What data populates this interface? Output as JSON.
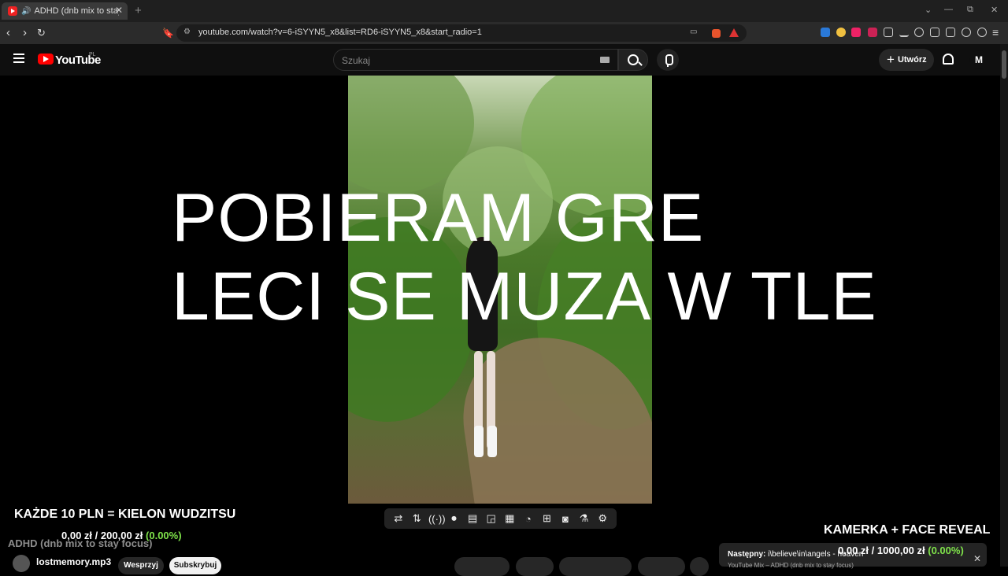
{
  "browser": {
    "tab_title": "ADHD (dnb mix to stay focus)",
    "new_tab": "+",
    "url": "youtube.com/watch?v=6-iSYYN5_x8&list=RD6-iSYYN5_x8&start_radio=1",
    "win_controls": [
      "⌄",
      "—",
      "⧉",
      "✕"
    ]
  },
  "youtube": {
    "logo_text": "YouTube",
    "country": "PL",
    "search_placeholder": "Szukaj",
    "create_label": "Utwórz",
    "avatar_letter": "M"
  },
  "video": {
    "overlay_line1": "POBIERAM GRE",
    "overlay_line2": "LECI SE MUZA W TLE"
  },
  "stream_overlay": {
    "goal_left_title": "KAŻDE 10 PLN = KIELON WUDZITSU",
    "goal_left_current": "0,00 zł",
    "goal_left_sep": "/",
    "goal_left_target": "200,00 zł",
    "goal_left_pct": "(0.00%)",
    "goal_right_title": "KAMERKA + FACE REVEAL",
    "goal_right_current": "0,00 zł",
    "goal_right_sep": "/",
    "goal_right_target": "1000,00 zł",
    "goal_right_pct": "(0.00%)"
  },
  "below_video": {
    "video_title": "ADHD (dnb mix to stay focus)",
    "channel_name": "lostmemory.mp3",
    "join_label": "Wesprzyj",
    "subscribe_label": "Subskrybuj"
  },
  "next_up": {
    "label": "Następny:",
    "title": "i\\believe\\in\\angels - heaven",
    "subtitle": "YouTube Mix – ADHD (dnb mix to stay focus)"
  },
  "player_controls": [
    "loop",
    "sort",
    "broadcast",
    "rec",
    "film",
    "pip",
    "screen",
    "speed",
    "add",
    "camera",
    "lab",
    "gear"
  ],
  "colors": {
    "accent_green": "#7fe34a",
    "yt_red": "#ff0000",
    "bg": "#0f0f0f"
  }
}
